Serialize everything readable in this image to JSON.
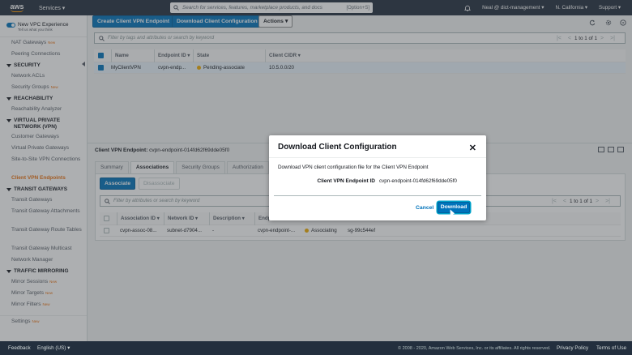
{
  "topnav": {
    "logo": "aws",
    "services": "Services ▾",
    "search_placeholder": "Search for services, features, marketplace products, and docs",
    "search_shortcut": "[Option+S]",
    "user": "Neal @ dict-management ▾",
    "region": "N. California ▾",
    "support": "Support ▾"
  },
  "sidebar": {
    "vpc_experience": "New VPC Experience",
    "vpc_experience_sub": "Tell us what you think",
    "new_badge": "New",
    "items_top": [
      {
        "label": "NAT Gateways",
        "new": true
      },
      {
        "label": "Peering Connections",
        "new": false
      }
    ],
    "security": {
      "title": "SECURITY",
      "items": [
        {
          "label": "Network ACLs",
          "new": false
        },
        {
          "label": "Security Groups",
          "new": true
        }
      ]
    },
    "reachability": {
      "title": "REACHABILITY",
      "items": [
        {
          "label": "Reachability Analyzer",
          "new": false
        }
      ]
    },
    "vpn": {
      "title": "VIRTUAL PRIVATE NETWORK (VPN)",
      "items": [
        "Customer Gateways",
        "Virtual Private Gateways",
        "Site-to-Site VPN Connections",
        "Client VPN Endpoints"
      ]
    },
    "tgw": {
      "title": "TRANSIT GATEWAYS",
      "items": [
        "Transit Gateways",
        "Transit Gateway Attachments",
        "Transit Gateway Route Tables",
        "Transit Gateway Multicast",
        "Network Manager"
      ]
    },
    "mirroring": {
      "title": "TRAFFIC MIRRORING",
      "items": [
        "Mirror Sessions",
        "Mirror Targets",
        "Mirror Filters"
      ]
    },
    "settings": "Settings"
  },
  "toolbar": {
    "create": "Create Client VPN Endpoint",
    "download": "Download Client Configuration",
    "actions": "Actions ▾"
  },
  "filter": {
    "placeholder": "Filter by tags and attributes or search by keyword",
    "pager": "1 to 1 of 1"
  },
  "table": {
    "columns": [
      "Name",
      "Endpoint ID ▾",
      "State",
      "Client CIDR ▾"
    ],
    "row": {
      "name": "MyClientVPN",
      "endpoint": "cvpn-endp...",
      "state": "Pending-associate",
      "cidr": "10.5.0.0/20"
    }
  },
  "details": {
    "title_label": "Client VPN Endpoint:",
    "title_id": "cvpn-endpoint-014fd62f69dde05f0",
    "tabs": [
      "Summary",
      "Associations",
      "Security Groups",
      "Authorization"
    ],
    "associate": "Associate",
    "disassociate": "Disassociate",
    "filter_placeholder": "Filter by attributes or search by keyword",
    "pager": "1 to 1 of 1",
    "columns": [
      "Association ID ▾",
      "Network ID ▾",
      "Description ▾",
      "Endpoint ID"
    ],
    "row": {
      "assoc": "cvpn-assoc-08...",
      "network": "subnet-d7904...",
      "desc": "-",
      "endpoint": "cvpn-endpoint-...",
      "status": "Associating",
      "sg": "sg-99c544ef"
    }
  },
  "modal": {
    "title": "Download Client Configuration",
    "close": "✕",
    "description": "Download VPN client configuration file for the Client VPN Endpoint",
    "label": "Client VPN Endpoint ID",
    "value": "cvpn-endpoint-014fd62f69dde05f0",
    "cancel": "Cancel",
    "download": "Download"
  },
  "footer": {
    "feedback": "Feedback",
    "language": "English (US) ▾",
    "copyright": "© 2008 - 2020, Amazon Web Services, Inc. or its affiliates. All rights reserved.",
    "privacy": "Privacy Policy",
    "terms": "Terms of Use"
  }
}
